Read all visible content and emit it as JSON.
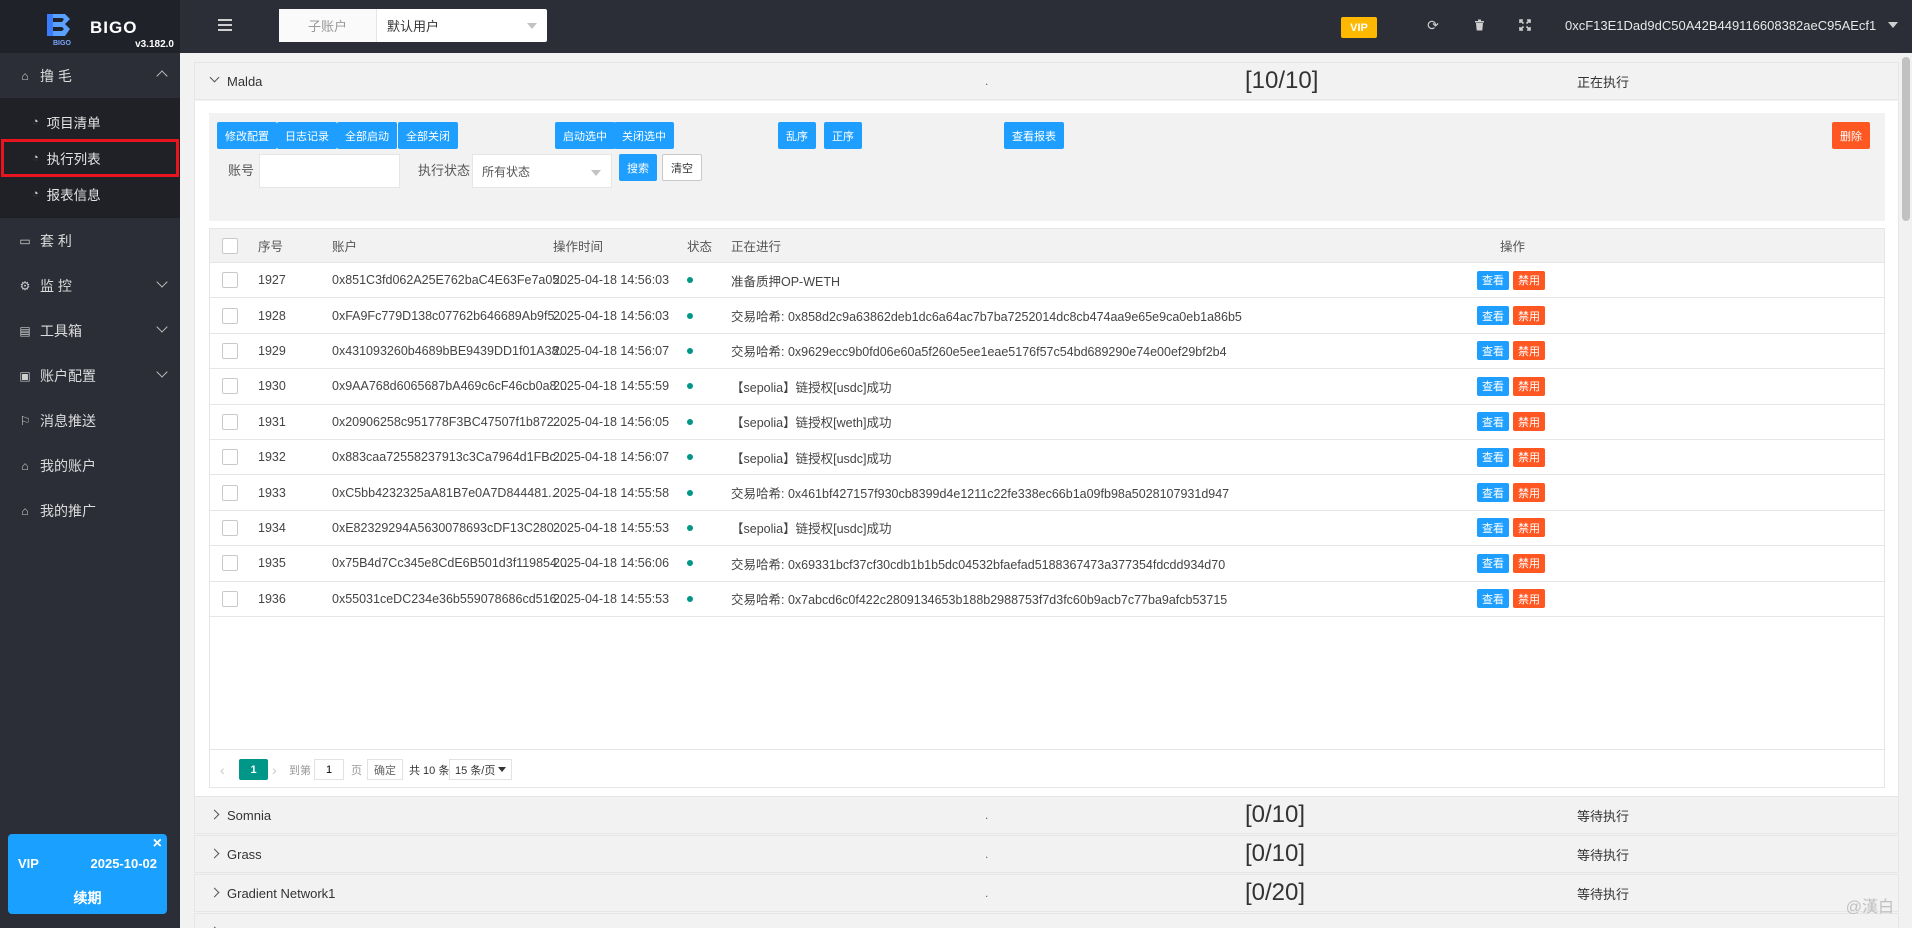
{
  "app": {
    "brand": "BIGO",
    "brand_sub": "BIGO",
    "version": "v3.182.0"
  },
  "sidebar": {
    "groups": [
      {
        "label": "撸 毛",
        "icon": "home-icon"
      },
      {
        "label": "套 利",
        "icon": "window-icon"
      },
      {
        "label": "监 控",
        "icon": "gears-icon"
      },
      {
        "label": "工具箱",
        "icon": "document-icon"
      },
      {
        "label": "账户配置",
        "icon": "briefcase-icon"
      },
      {
        "label": "消息推送",
        "icon": "flag-icon"
      },
      {
        "label": "我的账户",
        "icon": "home-icon"
      },
      {
        "label": "我的推广",
        "icon": "home-icon"
      }
    ],
    "sub_items": [
      {
        "label": "项目清单",
        "icon": "dashboard-icon"
      },
      {
        "label": "执行列表",
        "icon": "dashboard-icon"
      },
      {
        "label": "报表信息",
        "icon": "dashboard-icon"
      }
    ],
    "vip": {
      "label": "VIP",
      "date": "2025-10-02",
      "renew": "续期"
    }
  },
  "header": {
    "sub_account_label": "子账户",
    "sub_account_value": "默认用户",
    "vip_badge": "VIP",
    "wallet": "0xcF13E1Dad9dC50A42B449116608382aeC95AEcf1",
    "icons": [
      "refresh-icon",
      "trash-icon",
      "fullscreen-icon"
    ]
  },
  "panels": [
    {
      "name": "Malda",
      "dot": ".",
      "count": "[10/10]",
      "status": "正在执行",
      "expanded": true
    },
    {
      "name": "Somnia",
      "dot": ".",
      "count": "[0/10]",
      "status": "等待执行"
    },
    {
      "name": "Grass",
      "dot": ".",
      "count": "[0/10]",
      "status": "等待执行"
    },
    {
      "name": "Gradient Network1",
      "dot": ".",
      "count": "[0/20]",
      "status": "等待执行"
    }
  ],
  "toolbar": {
    "buttons": [
      "修改配置",
      "日志记录",
      "全部启动",
      "全部关闭",
      "启动选中",
      "关闭选中",
      "乱序",
      "正序",
      "查看报表",
      "删除"
    ],
    "account_label": "账号",
    "account_value": "",
    "status_label": "执行状态",
    "status_value": "所有状态",
    "search": "搜索",
    "clear": "清空"
  },
  "table": {
    "headers": [
      "序号",
      "账户",
      "操作时间",
      "状态",
      "正在进行",
      "操作"
    ],
    "view_label": "查看",
    "ban_label": "禁用",
    "rows": [
      {
        "id": "1927",
        "account": "0x851C3fd062A25E762baC4E63Fe7a05...",
        "time": "2025-04-18 14:56:03",
        "progress": "准备质押OP-WETH"
      },
      {
        "id": "1928",
        "account": "0xFA9Fc779D138c07762b646689Ab9f5...",
        "time": "2025-04-18 14:56:03",
        "progress": "交易哈希: 0x858d2c9a63862deb1dc6a64ac7b7ba7252014dc8cb474aa9e65e9ca0eb1a86b5"
      },
      {
        "id": "1929",
        "account": "0x431093260b4689bBE9439DD1f01A38...",
        "time": "2025-04-18 14:56:07",
        "progress": "交易哈希: 0x9629ecc9b0fd06e60a5f260e5ee1eae5176f57c54bd689290e74e00ef29bf2b4"
      },
      {
        "id": "1930",
        "account": "0x9AA768d6065687bA469c6cF46cb0a8...",
        "time": "2025-04-18 14:55:59",
        "progress": "【sepolia】链授权[usdc]成功"
      },
      {
        "id": "1931",
        "account": "0x20906258c951778F3BC47507f1b872...",
        "time": "2025-04-18 14:56:05",
        "progress": "【sepolia】链授权[weth]成功"
      },
      {
        "id": "1932",
        "account": "0x883caa72558237913c3Ca7964d1FBc...",
        "time": "2025-04-18 14:56:07",
        "progress": "【sepolia】链授权[usdc]成功"
      },
      {
        "id": "1933",
        "account": "0xC5bb4232325aA81B7e0A7D844481...",
        "time": "2025-04-18 14:55:58",
        "progress": "交易哈希: 0x461bf427157f930cb8399d4e1211c22fe338ec66b1a09fb98a5028107931d947"
      },
      {
        "id": "1934",
        "account": "0xE82329294A5630078693cDF13C280...",
        "time": "2025-04-18 14:55:53",
        "progress": "【sepolia】链授权[usdc]成功"
      },
      {
        "id": "1935",
        "account": "0x75B4d7Cc345e8CdE6B501d3f119854...",
        "time": "2025-04-18 14:56:06",
        "progress": "交易哈希: 0x69331bcf37cf30cdb1b1b5dc04532bfaefad5188367473a377354fdcdd934d70"
      },
      {
        "id": "1936",
        "account": "0x55031ceDC234e36b559078686cd516...",
        "time": "2025-04-18 14:55:53",
        "progress": "交易哈希: 0x7abcd6c0f422c2809134653b188b2988753f7d3fc60b9acb7c77ba9afcb53715"
      }
    ]
  },
  "pager": {
    "current": "1",
    "goto_label": "到第",
    "goto_value": "1",
    "page_unit": "页",
    "confirm": "确定",
    "total": "共 10 条",
    "page_size": "15 条/页"
  },
  "watermark": "@漢白"
}
